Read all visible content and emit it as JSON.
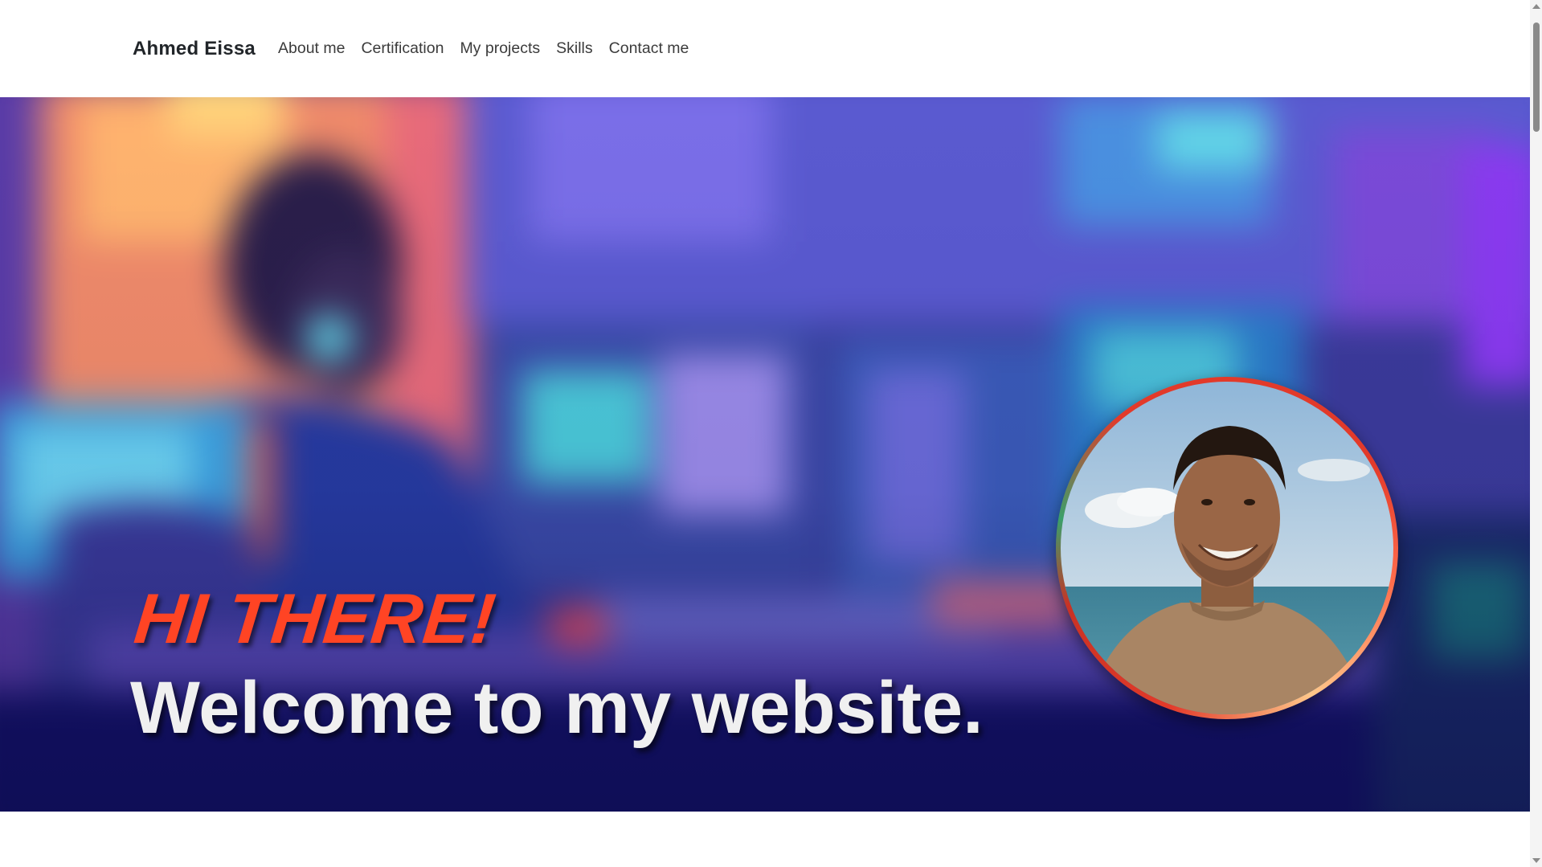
{
  "navbar": {
    "brand": "Ahmed Eissa",
    "links": [
      {
        "label": "About me"
      },
      {
        "label": "Certification"
      },
      {
        "label": "My projects"
      },
      {
        "label": "Skills"
      },
      {
        "label": "Contact me"
      }
    ]
  },
  "hero": {
    "greeting": "HI THERE!",
    "welcome": "Welcome to my website.",
    "background_image": "blurred illustration of developer at desk with monitors",
    "profile_image": "portrait photo in circular frame"
  },
  "colors": {
    "greeting": "#ff4424",
    "welcome": "#f0f0f0",
    "avatar_ring": "#e23a2a",
    "brand": "#212529"
  }
}
